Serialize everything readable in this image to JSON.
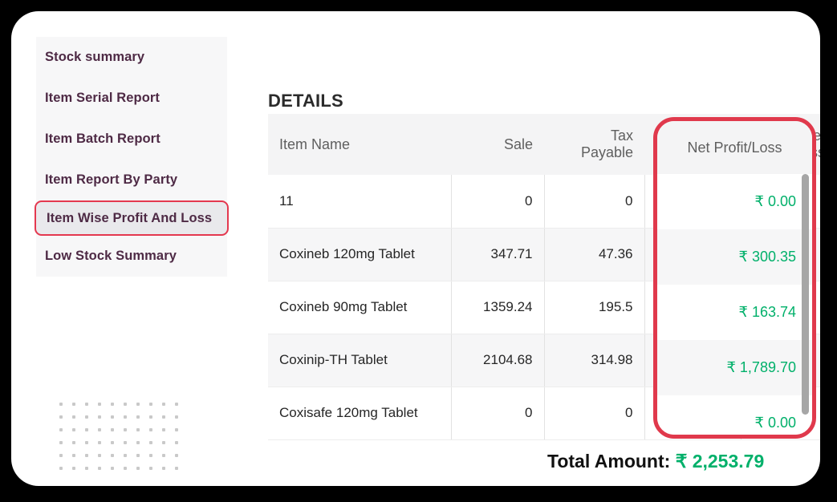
{
  "sidebar": {
    "items": [
      {
        "label": "Stock summary",
        "selected": false
      },
      {
        "label": "Item Serial Report",
        "selected": false
      },
      {
        "label": "Item Batch Report",
        "selected": false
      },
      {
        "label": "Item Report By Party",
        "selected": false
      },
      {
        "label": "Item Wise Profit And Loss",
        "selected": true
      },
      {
        "label": "Low Stock Summary",
        "selected": false
      }
    ]
  },
  "main": {
    "section_title": "DETAILS",
    "table": {
      "columns": [
        {
          "key": "item_name",
          "label": "Item Name",
          "align": "left"
        },
        {
          "key": "sale",
          "label": "Sale",
          "align": "right"
        },
        {
          "key": "tax_payable",
          "label": "Tax Payable",
          "align": "right"
        },
        {
          "key": "extra",
          "label": "",
          "align": "right"
        }
      ],
      "highlighted_column": {
        "label": "Net Profit/Loss",
        "align": "right"
      },
      "rows": [
        {
          "item_name": "11",
          "sale": "0",
          "tax_payable": "0",
          "extra": "",
          "net_profit_loss": "₹ 0.00"
        },
        {
          "item_name": "Coxineb 120mg Tablet",
          "sale": "347.71",
          "tax_payable": "47.36",
          "extra": "",
          "net_profit_loss": "₹ 300.35"
        },
        {
          "item_name": "Coxineb 90mg Tablet",
          "sale": "1359.24",
          "tax_payable": "195.5",
          "extra": "",
          "net_profit_loss": "₹ 163.74"
        },
        {
          "item_name": "Coxinip-TH Tablet",
          "sale": "2104.68",
          "tax_payable": "314.98",
          "extra": "",
          "net_profit_loss": "₹ 1,789.70"
        },
        {
          "item_name": "Coxisafe 120mg Tablet",
          "sale": "0",
          "tax_payable": "0",
          "extra": "",
          "net_profit_loss": "₹ 0.00"
        }
      ]
    },
    "total": {
      "label": "Total Amount:",
      "amount": "₹ 2,253.79"
    }
  },
  "colors": {
    "highlight_border": "#e0394c",
    "positive_value": "#00b06a",
    "sidebar_text": "#4e2a45",
    "selected_item_bg": "#e9e9ec",
    "header_bg": "#f4f4f5"
  }
}
